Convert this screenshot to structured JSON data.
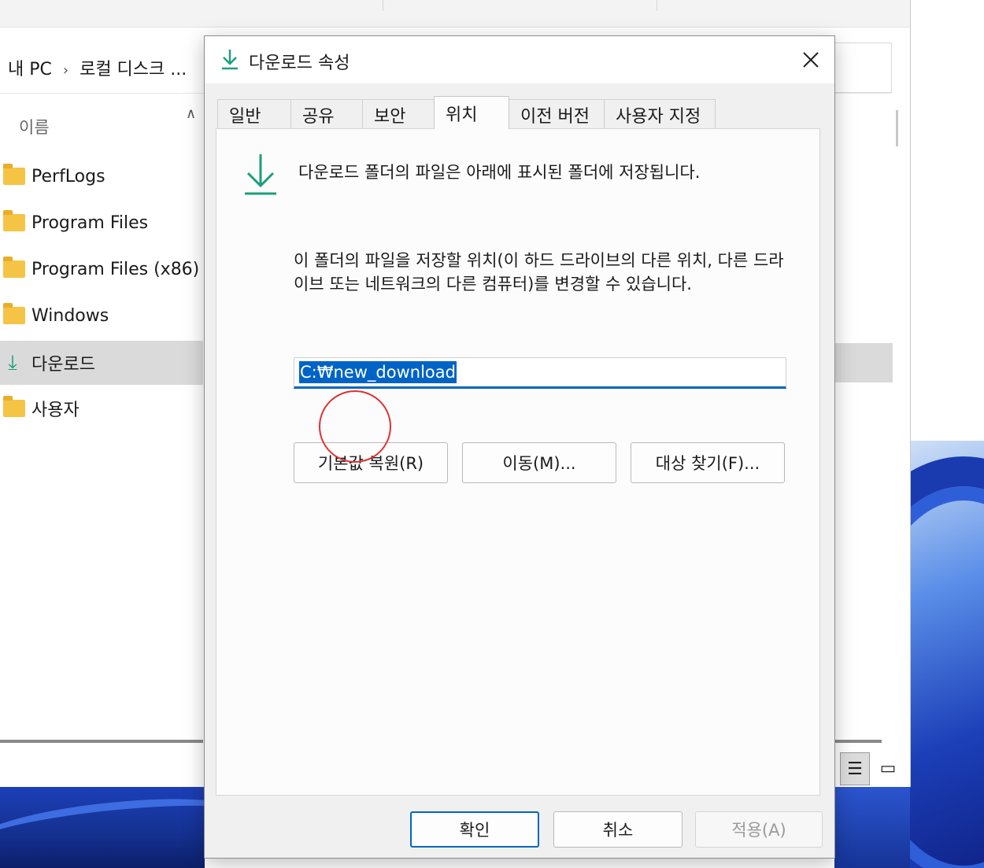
{
  "explorer": {
    "breadcrumb": [
      "내 PC",
      "로컬 디스크 ..."
    ],
    "breadcrumb_separator": "›",
    "column_header": "이름",
    "files": [
      {
        "name": "PerfLogs",
        "icon": "folder-icon"
      },
      {
        "name": "Program Files",
        "icon": "folder-icon"
      },
      {
        "name": "Program Files (x86)",
        "icon": "folder-icon"
      },
      {
        "name": "Windows",
        "icon": "folder-icon"
      },
      {
        "name": "다운로드",
        "icon": "download-icon",
        "selected": true
      },
      {
        "name": "사용자",
        "icon": "folder-icon"
      }
    ]
  },
  "dialog": {
    "title": "다운로드 속성",
    "tabs": [
      {
        "label": "일반"
      },
      {
        "label": "공유"
      },
      {
        "label": "보안"
      },
      {
        "label": "위치",
        "active": true
      },
      {
        "label": "이전 버전"
      },
      {
        "label": "사용자 지정"
      }
    ],
    "description_main": "다운로드 폴더의 파일은 아래에 표시된 폴더에 저장됩니다.",
    "description_move": "이 폴더의 파일을 저장할 위치(이 하드 드라이브의 다른 위치, 다른 드라이브 또는 네트워크의 다른 컴퓨터)를 변경할 수 있습니다.",
    "path_value": "C:₩new_download",
    "buttons": {
      "restore_default": "기본값 복원(R)",
      "move": "이동(M)...",
      "find_target": "대상 찾기(F)..."
    },
    "footer": {
      "ok": "확인",
      "cancel": "취소",
      "apply": "적용(A)"
    }
  },
  "colors": {
    "accent": "#0067c0",
    "download_green": "#1aa07a",
    "annotation_red": "#e03030",
    "folder_yellow": "#f6c445"
  }
}
